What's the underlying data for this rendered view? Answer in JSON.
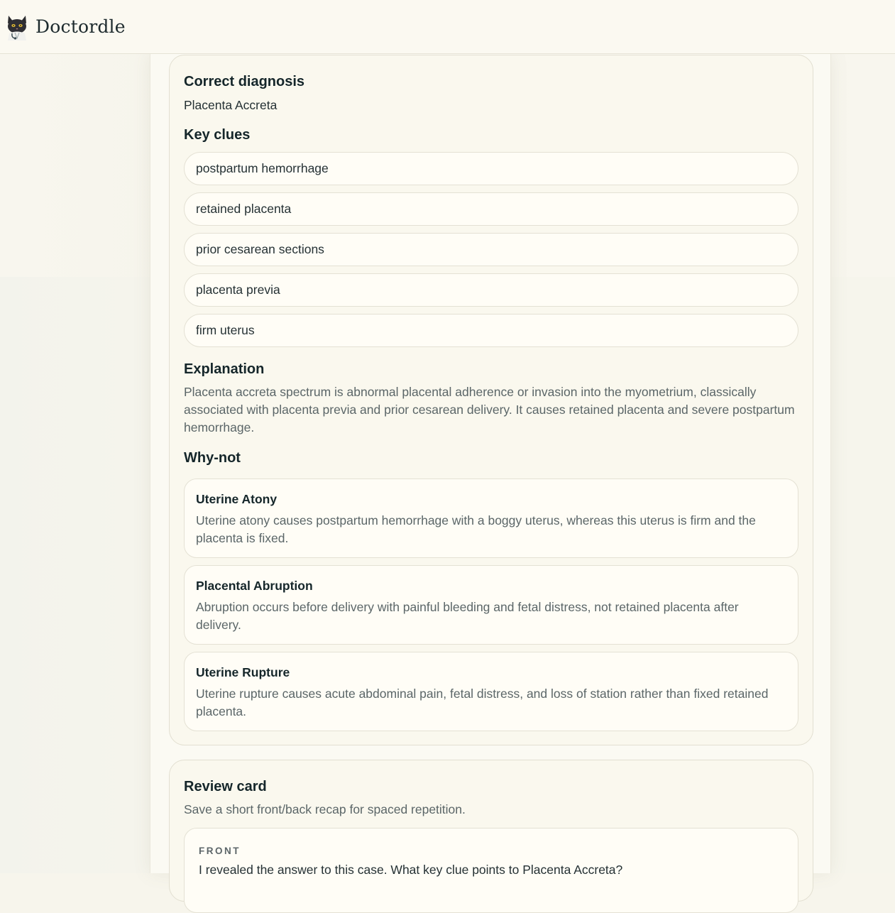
{
  "header": {
    "brand": "Doctordle",
    "logo_icon": "cat-doctor-icon"
  },
  "answer": {
    "correct_heading": "Correct diagnosis",
    "diagnosis": "Placenta Accreta",
    "clues_heading": "Key clues",
    "clues": [
      "postpartum hemorrhage",
      "retained placenta",
      "prior cesarean sections",
      "placenta previa",
      "firm uterus"
    ],
    "explanation_heading": "Explanation",
    "explanation": "Placenta accreta spectrum is abnormal placental adherence or invasion into the myometrium, classically associated with placenta previa and prior cesarean delivery. It causes retained placenta and severe postpartum hemorrhage.",
    "whynot_heading": "Why-not",
    "whynot": [
      {
        "title": "Uterine Atony",
        "text": "Uterine atony causes postpartum hemorrhage with a boggy uterus, whereas this uterus is firm and the placenta is fixed."
      },
      {
        "title": "Placental Abruption",
        "text": "Abruption occurs before delivery with painful bleeding and fetal distress, not retained placenta after delivery."
      },
      {
        "title": "Uterine Rupture",
        "text": "Uterine rupture causes acute abdominal pain, fetal distress, and loss of station rather than fixed retained placenta."
      }
    ]
  },
  "review": {
    "heading": "Review card",
    "subtitle": "Save a short front/back recap for spaced repetition.",
    "front_label": "FRONT",
    "front_text": "I revealed the answer to this case. What key clue points to Placenta Accreta?"
  }
}
